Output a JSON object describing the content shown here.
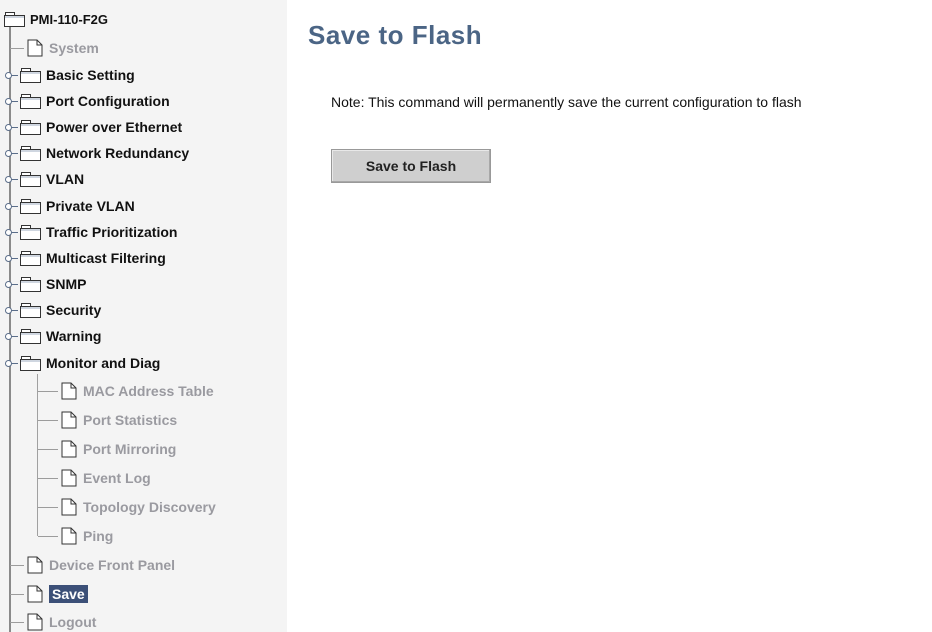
{
  "tree": {
    "root": {
      "label": "PMI-110-F2G",
      "icon": "folder-icon"
    },
    "items": [
      {
        "label": "System",
        "type": "leaf"
      },
      {
        "label": "Basic Setting",
        "type": "folder"
      },
      {
        "label": "Port Configuration",
        "type": "folder"
      },
      {
        "label": "Power over Ethernet",
        "type": "folder"
      },
      {
        "label": "Network Redundancy",
        "type": "folder"
      },
      {
        "label": "VLAN",
        "type": "folder"
      },
      {
        "label": "Private VLAN",
        "type": "folder"
      },
      {
        "label": "Traffic Prioritization",
        "type": "folder"
      },
      {
        "label": "Multicast Filtering",
        "type": "folder"
      },
      {
        "label": "SNMP",
        "type": "folder"
      },
      {
        "label": "Security",
        "type": "folder"
      },
      {
        "label": "Warning",
        "type": "folder"
      },
      {
        "label": "Monitor and Diag",
        "type": "folder",
        "expanded": true
      }
    ],
    "monitor_children": [
      {
        "label": "MAC Address Table"
      },
      {
        "label": "Port Statistics"
      },
      {
        "label": "Port Mirroring"
      },
      {
        "label": "Event Log"
      },
      {
        "label": "Topology Discovery"
      },
      {
        "label": "Ping"
      }
    ],
    "bottom_items": [
      {
        "label": "Device Front Panel"
      },
      {
        "label": "Save",
        "selected": true
      },
      {
        "label": "Logout"
      }
    ]
  },
  "main": {
    "title": "Save to Flash",
    "note": "Note: This command will permanently save the current configuration to flash",
    "save_button_label": "Save to Flash"
  },
  "colors": {
    "title": "#4b6585",
    "selected_bg": "#3c5078",
    "leaf_text": "#9a9aa0",
    "button_bg": "#cfcfcf",
    "sidebar_bg": "#f4f4f4"
  }
}
